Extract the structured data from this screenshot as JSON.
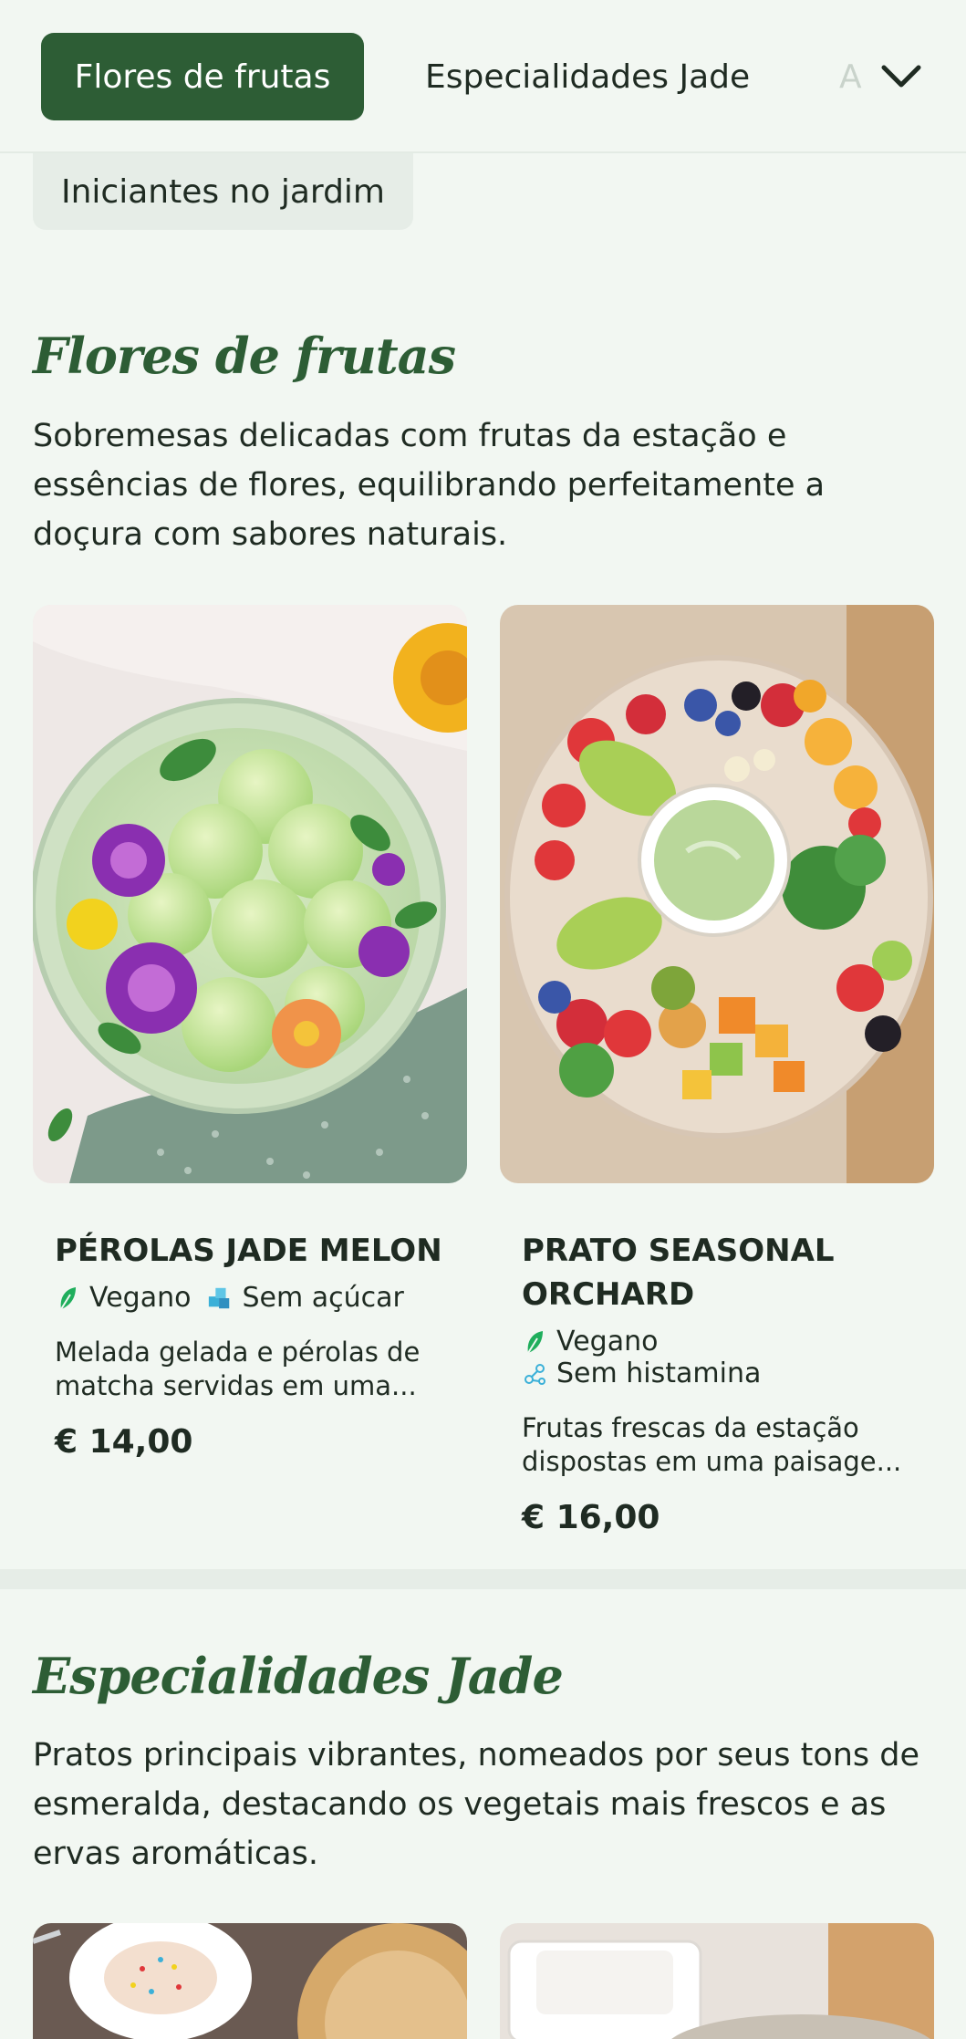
{
  "nav": {
    "tabs": [
      {
        "label": "Flores de frutas"
      },
      {
        "label": "Especialidades Jade"
      },
      {
        "label": "A"
      }
    ],
    "second_row": {
      "label": "Iniciantes no jardim"
    },
    "expand_icon": "chevron-down-icon"
  },
  "sections": [
    {
      "title": "Flores de frutas",
      "description": "Sobremesas delicadas com frutas da estação e essências de flores, equilibrando perfeitamente a doçura com sabores naturais.",
      "items": [
        {
          "name": "PÉROLAS JADE MELON",
          "tags": [
            {
              "label": "Vegano",
              "icon": "leaf-icon"
            },
            {
              "label": "Sem açúcar",
              "icon": "sugar-cubes-icon"
            }
          ],
          "description": "Melada gelada e pérolas de matcha servidas em uma...",
          "price": "€ 14,00"
        },
        {
          "name": "PRATO SEASONAL ORCHARD",
          "tags": [
            {
              "label": "Vegano",
              "icon": "leaf-icon"
            },
            {
              "label": "Sem histamina",
              "icon": "molecule-icon"
            }
          ],
          "description": "Frutas frescas da estação dispostas em uma paisage...",
          "price": "€ 16,00"
        }
      ]
    },
    {
      "title": "Especialidades Jade",
      "description": "Pratos principais vibrantes, nomeados por seus tons de esmeralda, destacando os vegetais mais frescos e as ervas aromáticas."
    }
  ],
  "colors": {
    "brand_green": "#2d5d35",
    "background": "#f2f7f2",
    "leaf_icon": "#1fae5c",
    "sugar_icon": "#3bb0d8"
  }
}
